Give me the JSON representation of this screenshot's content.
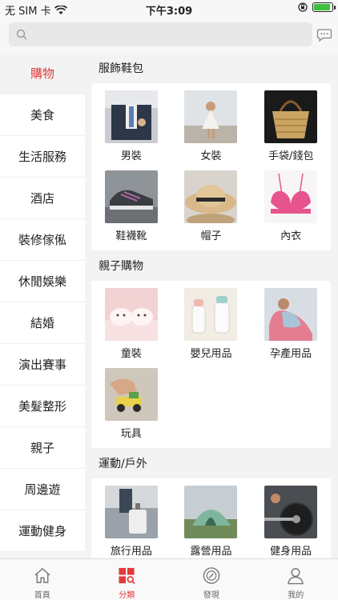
{
  "status_bar": {
    "carrier": "无 SIM 卡",
    "time": "下午3:09",
    "battery_level": 0.92
  },
  "search": {
    "placeholder": ""
  },
  "sidebar": {
    "items": [
      {
        "label": "購物",
        "active": true
      },
      {
        "label": "美食"
      },
      {
        "label": "生活服務"
      },
      {
        "label": "酒店"
      },
      {
        "label": "裝修傢俬"
      },
      {
        "label": "休閒娛樂"
      },
      {
        "label": "結婚"
      },
      {
        "label": "演出賽事"
      },
      {
        "label": "美髮整形"
      },
      {
        "label": "親子"
      },
      {
        "label": "周邊遊"
      },
      {
        "label": "運動健身"
      }
    ]
  },
  "sections": [
    {
      "title": "服飾鞋包",
      "items": [
        "男裝",
        "女裝",
        "手袋/錢包",
        "鞋襪靴",
        "帽子",
        "內衣"
      ]
    },
    {
      "title": "親子購物",
      "items": [
        "童裝",
        "嬰兒用品",
        "孕產用品",
        "玩具"
      ]
    },
    {
      "title": "運動/戶外",
      "items": [
        "旅行用品",
        "露營用品",
        "健身用品"
      ]
    }
  ],
  "tabbar": {
    "items": [
      {
        "label": "首頁",
        "icon": "home-icon"
      },
      {
        "label": "分類",
        "icon": "category-icon",
        "active": true
      },
      {
        "label": "發現",
        "icon": "compass-icon"
      },
      {
        "label": "我的",
        "icon": "profile-icon"
      }
    ]
  },
  "colors": {
    "accent": "#e23a3a",
    "battery": "#3cc13c"
  }
}
